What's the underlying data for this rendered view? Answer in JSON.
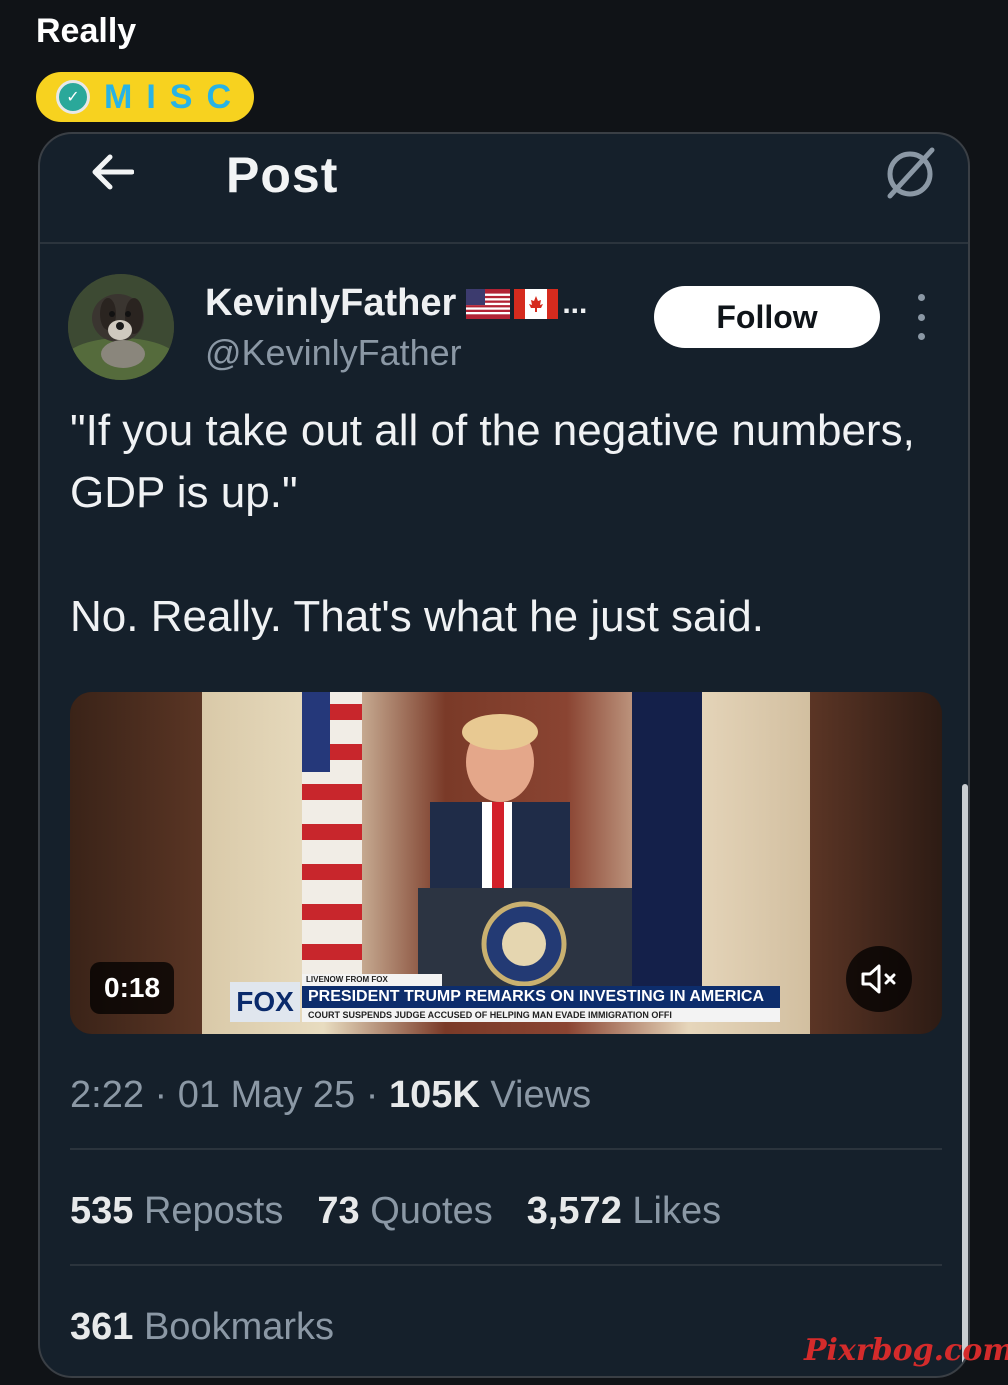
{
  "page": {
    "title": "Really"
  },
  "flair": {
    "label": "MISC",
    "badge_icon": "check-badge-icon",
    "background": "#f7d21f",
    "text_color": "#27b3e6"
  },
  "topbar": {
    "title": "Post",
    "back_icon": "arrow-left-icon",
    "grok_icon": "grok-slash-icon"
  },
  "author": {
    "display_name": "KevinlyFather",
    "flags": [
      "us-flag-icon",
      "canada-flag-icon"
    ],
    "ellipsis": "...",
    "handle": "@KevinlyFather",
    "follow_label": "Follow"
  },
  "post": {
    "paragraph_1": "\"If you take out all of the negative numbers, GDP is up.\"",
    "paragraph_2": "No. Really. That's what he just said."
  },
  "video": {
    "duration": "0:18",
    "mute_icon": "speaker-muted-icon",
    "chyron_network": "FOX",
    "chyron_tag": "LIVENOW FROM FOX",
    "chyron_headline": "PRESIDENT TRUMP REMARKS ON INVESTING IN AMERICA",
    "chyron_subline": "COURT SUSPENDS JUDGE ACCUSED OF HELPING MAN EVADE IMMIGRATION OFFI"
  },
  "meta": {
    "time": "2:22",
    "sep1": " · ",
    "date": "01 May 25",
    "sep2": " · ",
    "views_count": "105K",
    "views_label": " Views"
  },
  "stats": {
    "reposts_count": "535",
    "reposts_label": " Reposts",
    "quotes_count": "73",
    "quotes_label": " Quotes",
    "likes_count": "3,572",
    "likes_label": " Likes",
    "bookmarks_count": "361",
    "bookmarks_label": " Bookmarks"
  },
  "watermark": "Pixrbog.com",
  "colors": {
    "background": "#101317",
    "card": "#15202b",
    "secondary_text": "#8b98a5"
  }
}
